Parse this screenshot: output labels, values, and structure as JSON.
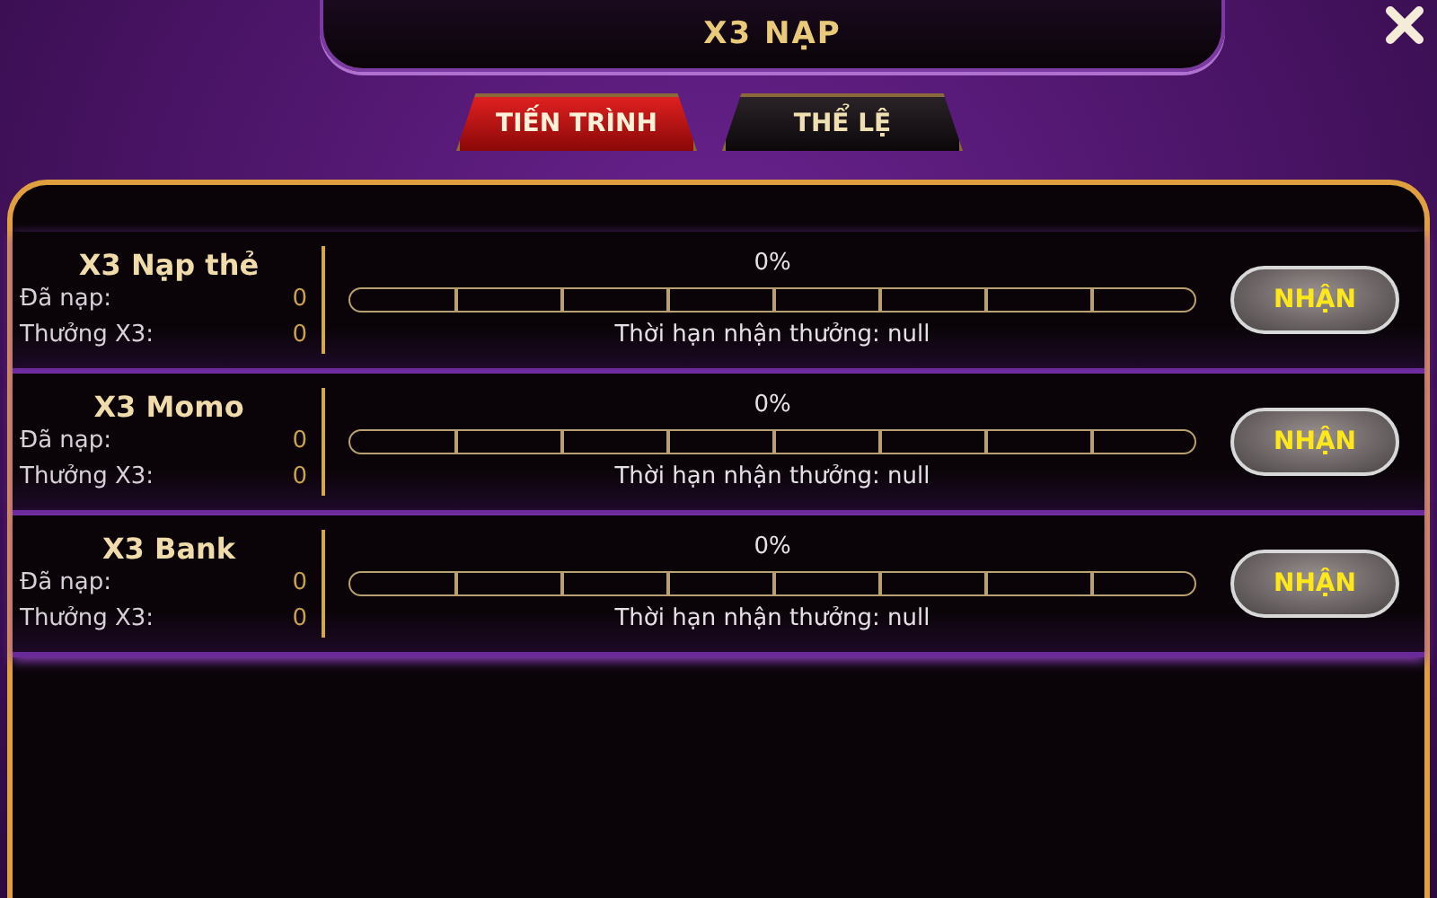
{
  "title": "X3 NẠP",
  "tabs": [
    {
      "label": "TIẾN TRÌNH",
      "selected": true
    },
    {
      "label": "THỂ LỆ",
      "selected": false
    }
  ],
  "rows": [
    {
      "name": "X3 Nạp thẻ",
      "deposited_label": "Đã nạp:",
      "deposited": "0",
      "bonus_label": "Thưởng X3:",
      "bonus": "0",
      "percent": "0%",
      "deadline": "Thời hạn nhận thưởng: null",
      "button": "NHẬN"
    },
    {
      "name": "X3 Momo",
      "deposited_label": "Đã nạp:",
      "deposited": "0",
      "bonus_label": "Thưởng X3:",
      "bonus": "0",
      "percent": "0%",
      "deadline": "Thời hạn nhận thưởng: null",
      "button": "NHẬN"
    },
    {
      "name": "X3 Bank",
      "deposited_label": "Đã nạp:",
      "deposited": "0",
      "bonus_label": "Thưởng X3:",
      "bonus": "0",
      "percent": "0%",
      "deadline": "Thời hạn nhận thưởng: null",
      "button": "NHẬN"
    }
  ]
}
